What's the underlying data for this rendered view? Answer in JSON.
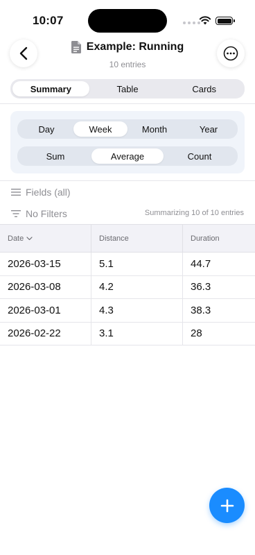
{
  "status": {
    "time": "10:07"
  },
  "header": {
    "title": "Example: Running",
    "subtitle": "10 entries"
  },
  "view_tabs": [
    {
      "label": "Summary",
      "active": true
    },
    {
      "label": "Table",
      "active": false
    },
    {
      "label": "Cards",
      "active": false
    }
  ],
  "period_tabs": [
    {
      "label": "Day",
      "active": false
    },
    {
      "label": "Week",
      "active": true
    },
    {
      "label": "Month",
      "active": false
    },
    {
      "label": "Year",
      "active": false
    }
  ],
  "aggregate_tabs": [
    {
      "label": "Sum",
      "active": false
    },
    {
      "label": "Average",
      "active": true
    },
    {
      "label": "Count",
      "active": false
    }
  ],
  "fields_label": "Fields (all)",
  "filters_label": "No Filters",
  "summary_note": "Summarizing 10 of 10 entries",
  "table": {
    "columns": [
      "Date",
      "Distance",
      "Duration"
    ],
    "rows": [
      [
        "2026-03-15",
        "5.1",
        "44.7"
      ],
      [
        "2026-03-08",
        "4.2",
        "36.3"
      ],
      [
        "2026-03-01",
        "4.3",
        "38.3"
      ],
      [
        "2026-02-22",
        "3.1",
        "28"
      ]
    ]
  },
  "colors": {
    "accent": "#1a8cff",
    "muted_text": "#8e8e93",
    "panel_bg": "#f0f4fa"
  },
  "icons": [
    "back-chevron-icon",
    "document-icon",
    "more-icon",
    "lines-icon",
    "filter-icon",
    "sort-chevron-icon",
    "plus-icon"
  ]
}
